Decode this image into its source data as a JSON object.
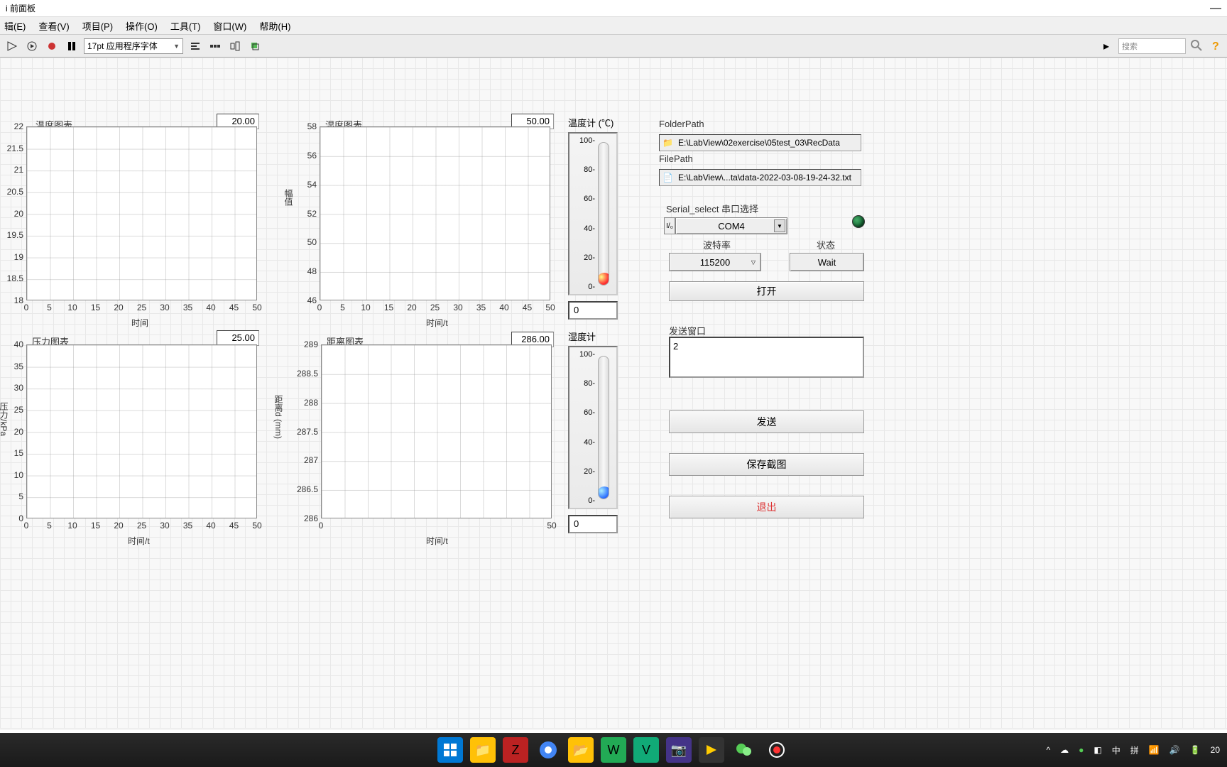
{
  "window": {
    "title": "i 前面板"
  },
  "menu": {
    "items": [
      "辑(E)",
      "查看(V)",
      "项目(P)",
      "操作(O)",
      "工具(T)",
      "窗口(W)",
      "帮助(H)"
    ]
  },
  "toolbar": {
    "font": "17pt 应用程序字体",
    "search_placeholder": "搜索"
  },
  "charts": {
    "temp": {
      "title": "温度图表",
      "value": "20.00",
      "xlabel": "时间",
      "yticks": [
        "22",
        "21.5",
        "21",
        "20.5",
        "20",
        "19.5",
        "19",
        "18.5",
        "18"
      ],
      "xticks": [
        "0",
        "5",
        "10",
        "15",
        "20",
        "25",
        "30",
        "35",
        "40",
        "45",
        "50"
      ]
    },
    "humid": {
      "title": "湿度图表",
      "value": "50.00",
      "xlabel": "时间/t",
      "ylabel": "幅值",
      "yticks": [
        "58",
        "56",
        "54",
        "52",
        "50",
        "48",
        "46"
      ],
      "xticks": [
        "0",
        "5",
        "10",
        "15",
        "20",
        "25",
        "30",
        "35",
        "40",
        "45",
        "50"
      ]
    },
    "press": {
      "title": "压力图表",
      "value": "25.00",
      "xlabel": "时间/t",
      "ylabel": "压力/kPa",
      "yticks": [
        "40",
        "35",
        "30",
        "25",
        "20",
        "15",
        "10",
        "5",
        "0"
      ],
      "xticks": [
        "0",
        "5",
        "10",
        "15",
        "20",
        "25",
        "30",
        "35",
        "40",
        "45",
        "50"
      ]
    },
    "dist": {
      "title": "距离图表",
      "value": "286.00",
      "xlabel": "时间/t",
      "ylabel": "距离d (mm)",
      "yticks": [
        "289",
        "288.5",
        "288",
        "287.5",
        "287",
        "286.5",
        "286"
      ],
      "xticks": [
        "0",
        "50"
      ]
    }
  },
  "thermo1": {
    "label": "温度计  (℃)",
    "ticks": [
      "100-",
      "80-",
      "60-",
      "40-",
      "20-",
      "0-"
    ],
    "readout": "0"
  },
  "thermo2": {
    "label": "湿度计",
    "ticks": [
      "100-",
      "80-",
      "60-",
      "40-",
      "20-",
      "0-"
    ],
    "readout": "0"
  },
  "paths": {
    "folder_label": "FolderPath",
    "folder": "E:\\LabView\\02exercise\\05test_03\\RecData",
    "file_label": "FilePath",
    "file": "E:\\LabView\\...ta\\data-2022-03-08-19-24-32.txt"
  },
  "serial": {
    "label": "Serial_select 串口选择",
    "port": "COM4",
    "baud_label": "波特率",
    "baud": "115200",
    "status_label": "状态",
    "status": "Wait"
  },
  "buttons": {
    "open": "打开",
    "send": "发送",
    "screenshot": "保存截图",
    "exit": "退出"
  },
  "sendbox": {
    "label": "发送窗口",
    "content": "2"
  },
  "chart_data": [
    {
      "type": "line",
      "title": "温度图表",
      "x": [],
      "values": [],
      "xlabel": "时间",
      "ylabel": "",
      "xlim": [
        0,
        50
      ],
      "ylim": [
        18,
        22
      ],
      "current": 20.0
    },
    {
      "type": "line",
      "title": "湿度图表",
      "x": [],
      "values": [],
      "xlabel": "时间/t",
      "ylabel": "幅值",
      "xlim": [
        0,
        50
      ],
      "ylim": [
        46,
        58
      ],
      "current": 50.0
    },
    {
      "type": "line",
      "title": "压力图表",
      "x": [],
      "values": [],
      "xlabel": "时间/t",
      "ylabel": "压力/kPa",
      "xlim": [
        0,
        50
      ],
      "ylim": [
        0,
        40
      ],
      "current": 25.0
    },
    {
      "type": "line",
      "title": "距离图表",
      "x": [],
      "values": [],
      "xlabel": "时间/t",
      "ylabel": "距离d (mm)",
      "xlim": [
        0,
        50
      ],
      "ylim": [
        286,
        289
      ],
      "current": 286.0
    }
  ],
  "tray": {
    "ime1": "中",
    "ime2": "拼",
    "time_small": "20"
  }
}
